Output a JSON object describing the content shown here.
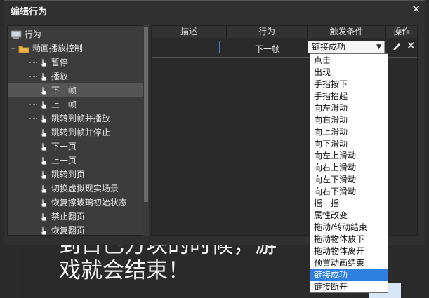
{
  "dialog": {
    "title": "编辑行为",
    "close": "✕"
  },
  "tree": {
    "root": "行为",
    "folder": "动画播放控制",
    "items": [
      "暂停",
      "播放",
      "下一帧",
      "上一帧",
      "跳转到帧并播放",
      "跳转到帧并停止",
      "下一页",
      "上一页",
      "跳转到页",
      "切换虚拟现实场景",
      "恢复擦玻璃初始状态",
      "禁止翻页",
      "恢复翻页"
    ],
    "selected_index": 2
  },
  "table": {
    "headers": [
      "描述",
      "行为",
      "触发条件",
      "操作"
    ],
    "row": {
      "description": "",
      "behavior": "下一帧",
      "trigger": "链接成功"
    }
  },
  "dropdown": {
    "options": [
      "点击",
      "出现",
      "手指按下",
      "手指抬起",
      "向左滑动",
      "向右滑动",
      "向上滑动",
      "向下滑动",
      "向左上滑动",
      "向右上滑动",
      "向左下滑动",
      "向右下滑动",
      "摇一摇",
      "属性改变",
      "拖动/转动结束",
      "拖动物体放下",
      "拖动物体离开",
      "预置动画结束",
      "链接成功",
      "链接断开"
    ],
    "selected": "链接成功"
  },
  "background": {
    "text": "到日已方块的时候，游\n戏就会结束！"
  }
}
